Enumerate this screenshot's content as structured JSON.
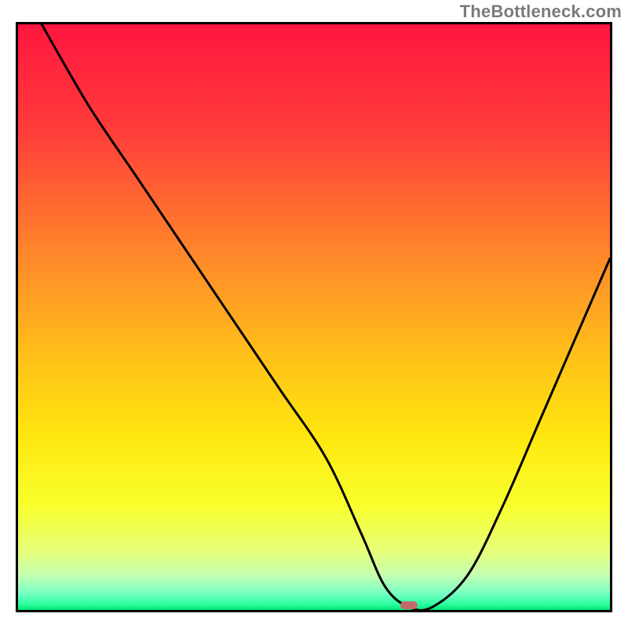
{
  "watermark": "TheBottleneck.com",
  "chart_data": {
    "type": "line",
    "title": "",
    "xlabel": "",
    "ylabel": "",
    "xlim": [
      0,
      100
    ],
    "ylim": [
      0,
      100
    ],
    "series": [
      {
        "name": "bottleneck-curve",
        "x": [
          4,
          12,
          20,
          28,
          36,
          44,
          52,
          58,
          62,
          66,
          70,
          76,
          82,
          88,
          94,
          100
        ],
        "y": [
          100,
          86,
          74,
          62,
          50,
          38,
          26,
          13,
          4,
          0.5,
          0.5,
          6,
          18,
          32,
          46,
          60
        ]
      }
    ],
    "marker": {
      "x": 66,
      "y": 0.8,
      "color": "#c46a6a"
    },
    "gradient_stops": [
      {
        "offset": 0,
        "color": "#ff163f"
      },
      {
        "offset": 18,
        "color": "#ff3c3a"
      },
      {
        "offset": 40,
        "color": "#ff8a2a"
      },
      {
        "offset": 58,
        "color": "#ffc418"
      },
      {
        "offset": 70,
        "color": "#ffe60f"
      },
      {
        "offset": 82,
        "color": "#f8ff2b"
      },
      {
        "offset": 90,
        "color": "#e6ff7a"
      },
      {
        "offset": 94,
        "color": "#c6ffb0"
      },
      {
        "offset": 97,
        "color": "#7dffc4"
      },
      {
        "offset": 99,
        "color": "#2dffa0"
      },
      {
        "offset": 100,
        "color": "#00e672"
      }
    ]
  }
}
